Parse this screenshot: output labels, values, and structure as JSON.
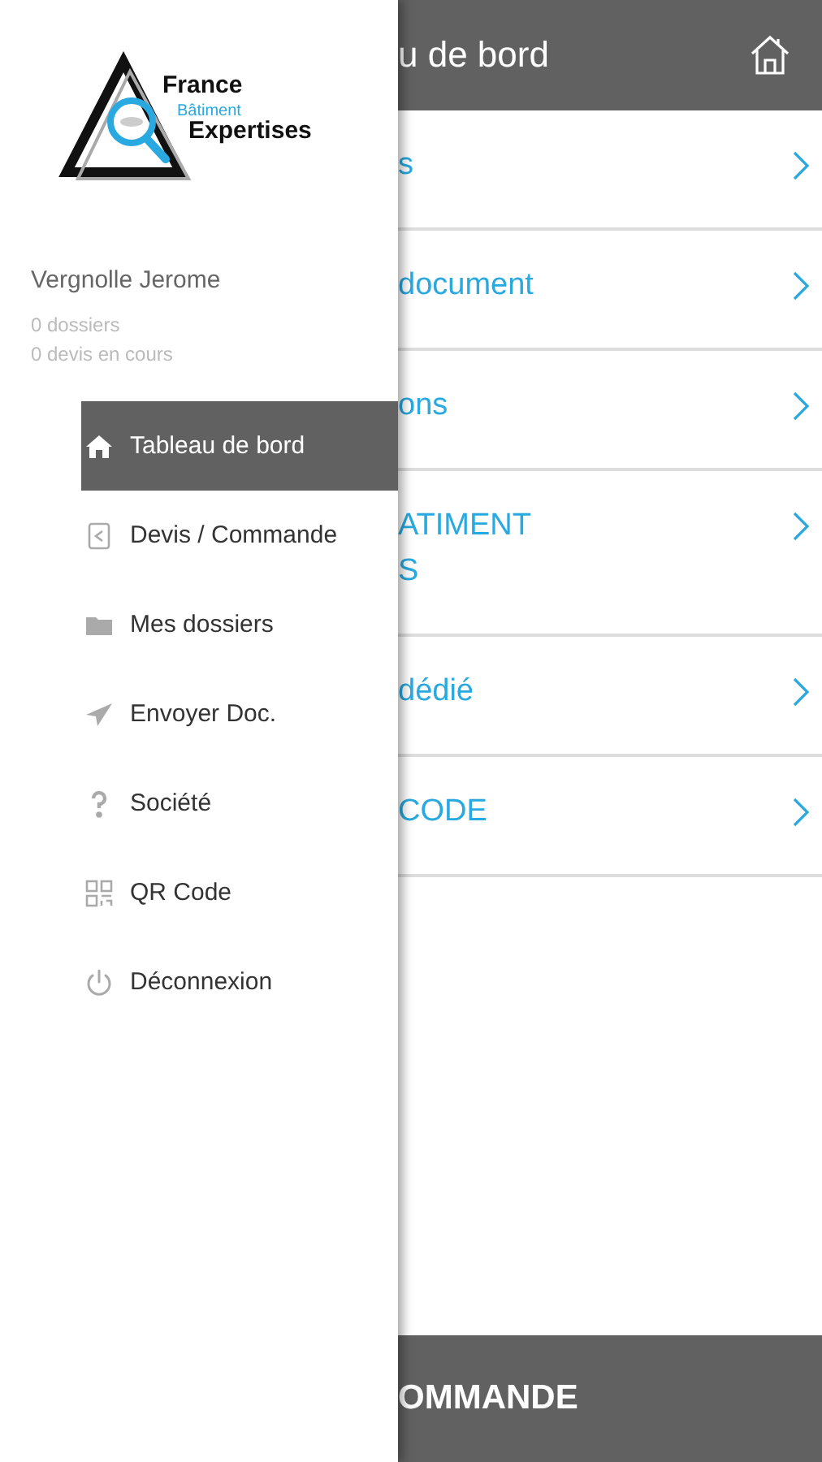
{
  "drawer": {
    "logo": {
      "line1": "France",
      "line2": "Bâtiment",
      "line3": "Expertises"
    },
    "user": {
      "name": "Vergnolle Jerome",
      "stats": [
        "0 dossiers",
        "0 devis en cours"
      ]
    },
    "menu": [
      {
        "label": "Tableau de bord",
        "kind": "home",
        "selected": true
      },
      {
        "label": "Devis / Commande",
        "kind": "document",
        "selected": false
      },
      {
        "label": "Mes dossiers",
        "kind": "folder",
        "selected": false
      },
      {
        "label": "Envoyer Doc.",
        "kind": "send",
        "selected": false
      },
      {
        "label": "Société",
        "kind": "question",
        "selected": false
      },
      {
        "label": "QR Code",
        "kind": "qr",
        "selected": false
      },
      {
        "label": "Déconnexion",
        "kind": "power",
        "selected": false
      }
    ]
  },
  "main": {
    "title": "u de bord",
    "rows": [
      {
        "lines": [
          "s"
        ]
      },
      {
        "lines": [
          "document"
        ]
      },
      {
        "lines": [
          "ons"
        ]
      },
      {
        "lines": [
          "ATIMENT",
          "S"
        ]
      },
      {
        "lines": [
          "dédié"
        ]
      },
      {
        "lines": [
          "CODE"
        ]
      }
    ],
    "bottom_bar": "OMMANDE"
  }
}
